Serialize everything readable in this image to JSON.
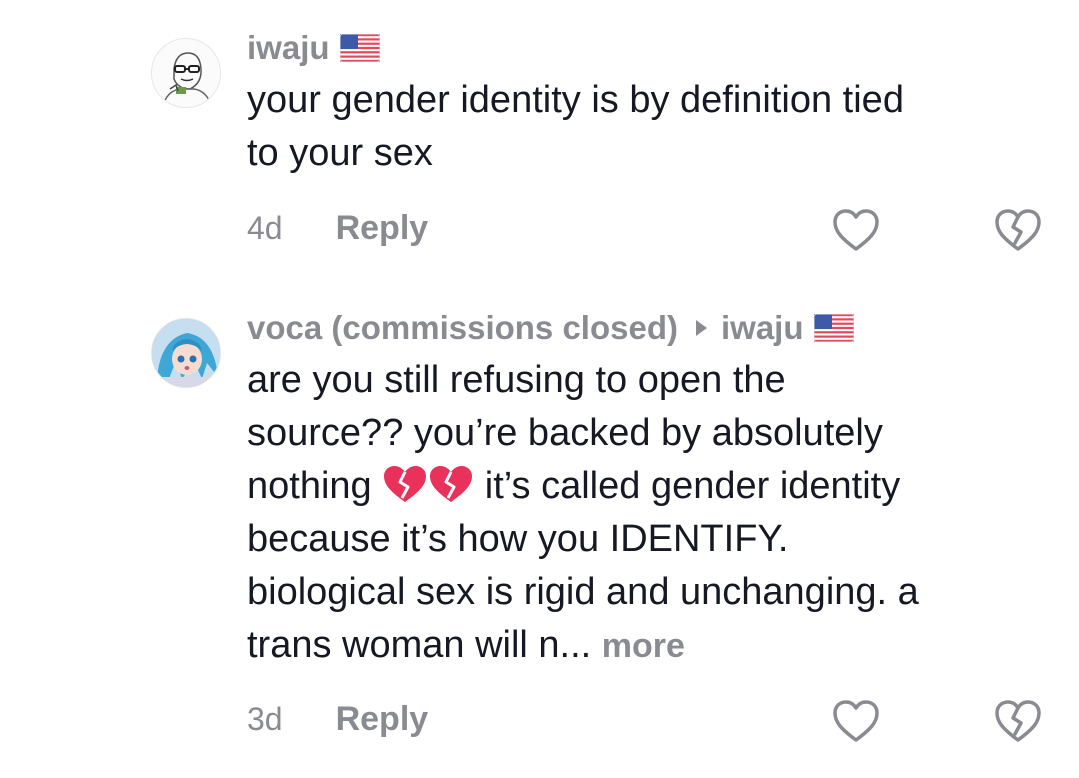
{
  "comments": [
    {
      "username": "iwaju",
      "flag_icon": "us-flag-icon",
      "text": "your gender identity is by definition tied\nto your sex",
      "age": "4d",
      "reply_label": "Reply"
    },
    {
      "username": "voca (commissions closed)",
      "reply_to": "iwaju",
      "flag_icon": "us-flag-icon",
      "text_part1": "are you still refusing to open the\nsource?? you’re backed by absolutely\nnothing ",
      "emoji": "broken-heart-emoji",
      "text_part2": " it’s called gender identity\nbecause it’s how you IDENTIFY.\nbiological sex is rigid and unchanging. a\ntrans woman will n...",
      "more_label": "more",
      "age": "3d",
      "reply_label": "Reply"
    }
  ],
  "colors": {
    "text": "#161823",
    "muted": "#8a8b91",
    "icon": "#8a8b91",
    "broken_heart": "#e8325a"
  }
}
